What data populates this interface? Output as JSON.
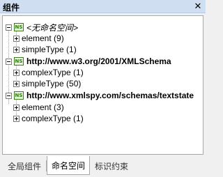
{
  "panel": {
    "title": "组件",
    "close_icon": "close-icon"
  },
  "tree": {
    "namespaces": [
      {
        "badge": "NS",
        "label": "<无命名空间>",
        "expanded": true,
        "children": [
          {
            "label": "element (9)"
          },
          {
            "label": "simpleType (1)"
          }
        ]
      },
      {
        "badge": "NS",
        "label": "http://www.w3.org/2001/XMLSchema",
        "expanded": true,
        "children": [
          {
            "label": "complexType (1)"
          },
          {
            "label": "simpleType (50)"
          }
        ]
      },
      {
        "badge": "NS",
        "label": "http://www.xmlspy.com/schemas/textstate",
        "expanded": true,
        "children": [
          {
            "label": "element (3)"
          },
          {
            "label": "complexType (1)"
          }
        ]
      }
    ]
  },
  "tabs": [
    {
      "label": "全局组件",
      "active": false
    },
    {
      "label": "命名空间",
      "active": true
    },
    {
      "label": "标识约束",
      "active": false
    }
  ]
}
